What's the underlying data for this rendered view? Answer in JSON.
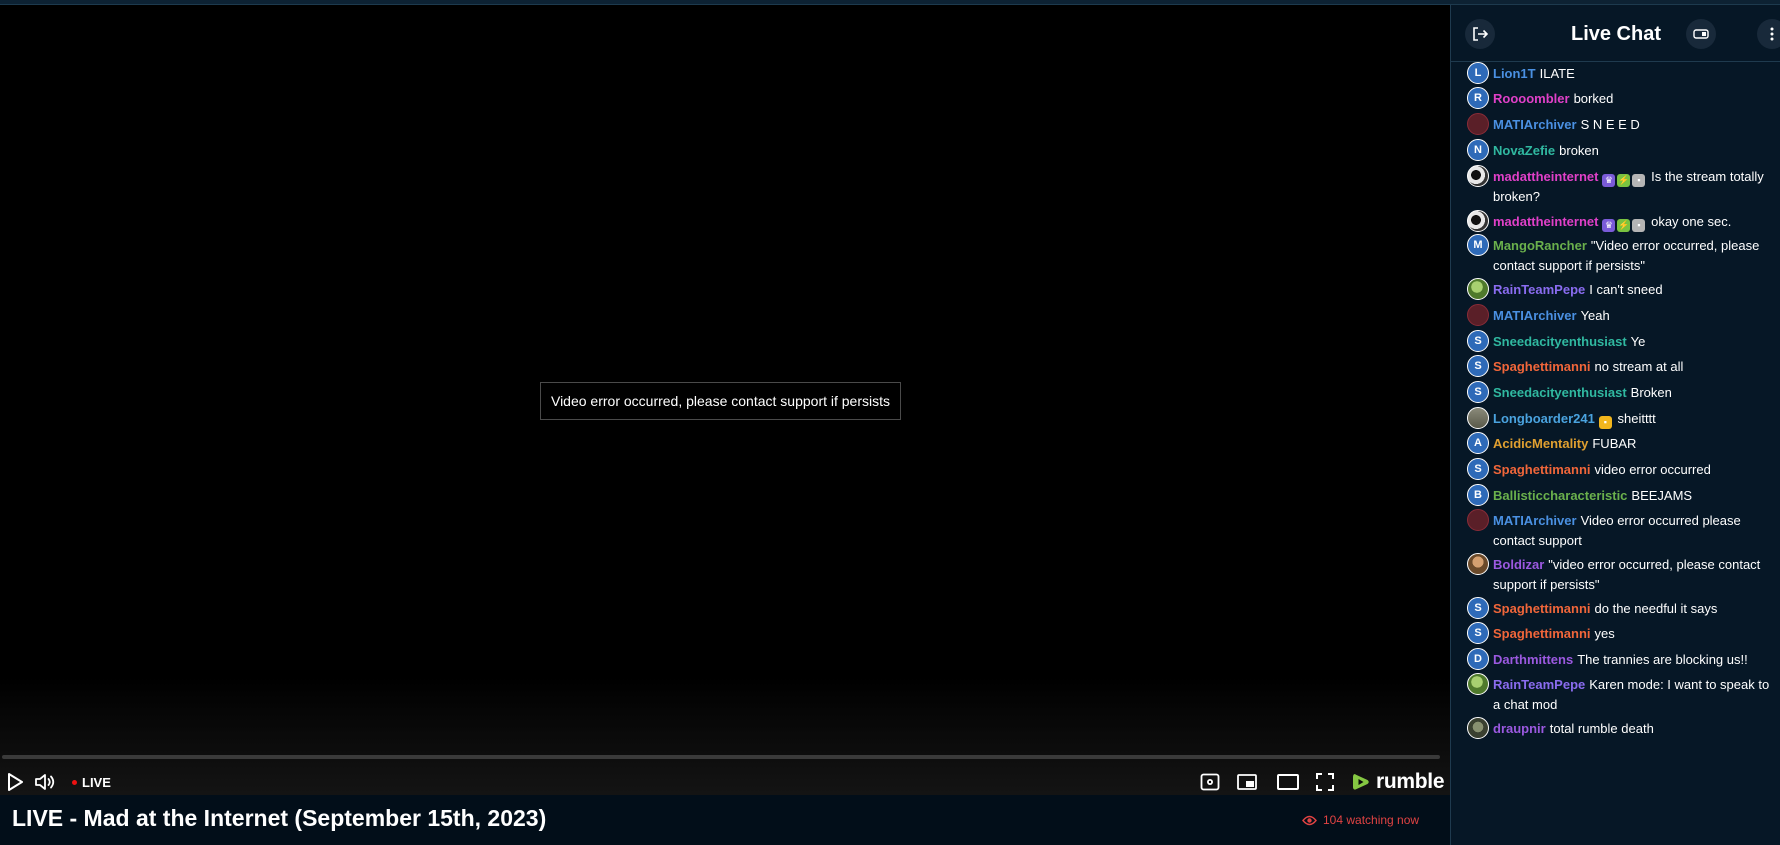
{
  "player": {
    "error_message": "Video error occurred, please contact support if persists",
    "live_label": "LIVE",
    "brand": "rumble"
  },
  "stream": {
    "title": "LIVE - Mad at the Internet (September 15th, 2023)",
    "watching": "104 watching now"
  },
  "chat": {
    "title": "Live Chat",
    "messages": [
      {
        "user": "Lion1T",
        "text": "ILATE",
        "initial": "L",
        "color": "#4a90e2"
      },
      {
        "user": "Roooombler",
        "text": "borked",
        "initial": "R",
        "color": "#e040c8"
      },
      {
        "user": "MATIArchiver",
        "text": "S N E E D",
        "initial": "",
        "color": "#4a90e2"
      },
      {
        "user": "NovaZefie",
        "text": "broken",
        "initial": "N",
        "color": "#30b8a0"
      },
      {
        "user": "madattheinternet",
        "text": "Is the stream totally broken?",
        "initial": "",
        "color": "#e040c8"
      },
      {
        "user": "madattheinternet",
        "text": "okay one sec.",
        "initial": "",
        "color": "#e040c8"
      },
      {
        "user": "MangoRancher",
        "text": "\"Video error occurred, please contact support if persists\"",
        "initial": "M",
        "color": "#6ab04c"
      },
      {
        "user": "RainTeamPepe",
        "text": "I can't sneed",
        "initial": "",
        "color": "#8a6cf0"
      },
      {
        "user": "MATIArchiver",
        "text": "Yeah",
        "initial": "",
        "color": "#4a90e2"
      },
      {
        "user": "Sneedacityenthusiast",
        "text": "Ye",
        "initial": "S",
        "color": "#30b8a0"
      },
      {
        "user": "Spaghettimanni",
        "text": "no stream at all",
        "initial": "S",
        "color": "#f0663a"
      },
      {
        "user": "Sneedacityenthusiast",
        "text": "Broken",
        "initial": "S",
        "color": "#30b8a0"
      },
      {
        "user": "Longboarder241",
        "text": "sheitttt",
        "initial": "",
        "color": "#4aa3df"
      },
      {
        "user": "AcidicMentality",
        "text": "FUBAR",
        "initial": "A",
        "color": "#e0a030"
      },
      {
        "user": "Spaghettimanni",
        "text": "video error occurred",
        "initial": "S",
        "color": "#f0663a"
      },
      {
        "user": "Ballisticcharacteristic",
        "text": "BEEJAMS",
        "initial": "B",
        "color": "#6ab04c"
      },
      {
        "user": "MATIArchiver",
        "text": "Video error occurred please contact support",
        "initial": "",
        "color": "#4a90e2"
      },
      {
        "user": "Boldizar",
        "text": "\"video error occurred, please contact support if persists\"",
        "initial": "",
        "color": "#9b59e0"
      },
      {
        "user": "Spaghettimanni",
        "text": "do the needful it says",
        "initial": "S",
        "color": "#f0663a"
      },
      {
        "user": "Spaghettimanni",
        "text": "yes",
        "initial": "S",
        "color": "#f0663a"
      },
      {
        "user": "Darthmittens",
        "text": "The trannies are blocking us!!",
        "initial": "D",
        "color": "#9b59e0"
      },
      {
        "user": "RainTeamPepe",
        "text": "Karen mode: I want to speak to a chat mod",
        "initial": "",
        "color": "#8a6cf0"
      },
      {
        "user": "draupnir",
        "text": "total rumble death",
        "initial": "",
        "color": "#9b59e0"
      }
    ]
  },
  "colors": {
    "accent_live": "#ee1111",
    "rumble_green": "#85c742",
    "watching_red": "#e14343"
  }
}
